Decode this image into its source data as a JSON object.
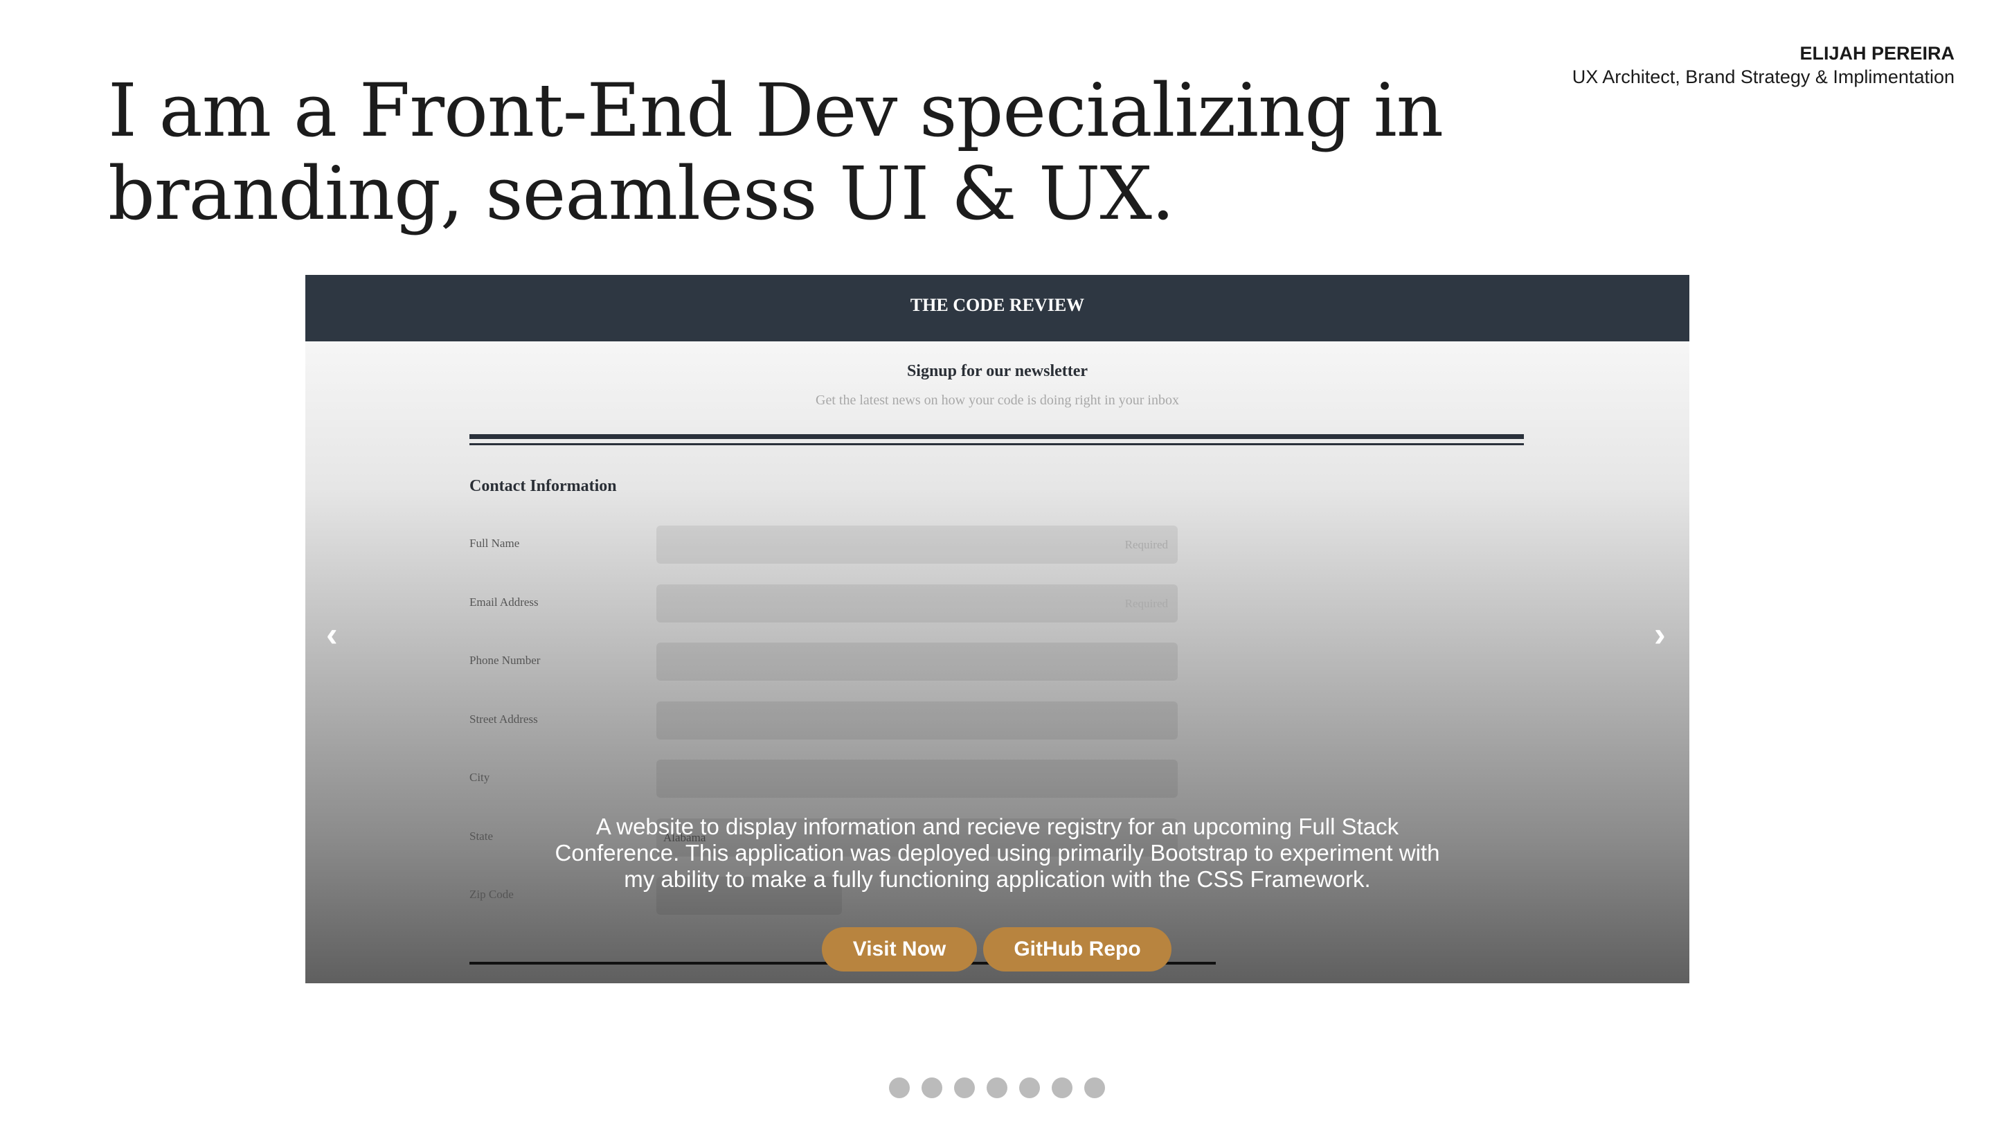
{
  "header": {
    "name": "ELIJAH PEREIRA",
    "role": "UX Architect, Brand Strategy & Implimentation"
  },
  "hero": {
    "line1": "I am a Front-End Dev specializing in",
    "line2": "branding, seamless UI & UX."
  },
  "slide": {
    "site_title": "THE CODE REVIEW",
    "signup_title": "Signup for our newsletter",
    "signup_subtitle": "Get the latest news on how your code is doing right in your inbox",
    "section": "Contact Information",
    "fields": [
      {
        "label": "Full Name",
        "placeholder": "Required"
      },
      {
        "label": "Email Address",
        "placeholder": "Required"
      },
      {
        "label": "Phone Number",
        "placeholder": ""
      },
      {
        "label": "Street Address",
        "placeholder": ""
      },
      {
        "label": "City",
        "placeholder": ""
      },
      {
        "label": "State",
        "value": "Alabama"
      },
      {
        "label": "Zip Code",
        "placeholder": ""
      }
    ],
    "description": "A website to display information and recieve registry for an upcoming Full Stack Conference. This application was deployed using primarily Bootstrap to experiment with my ability to make a fully functioning application with the CSS Framework.",
    "visit_label": "Visit Now",
    "repo_label": "GitHub Repo",
    "prev": "‹",
    "next": "›"
  },
  "carousel": {
    "count": 7,
    "active": 0
  },
  "colors": {
    "accent": "#b8843f",
    "header_bg": "#2e3742"
  }
}
